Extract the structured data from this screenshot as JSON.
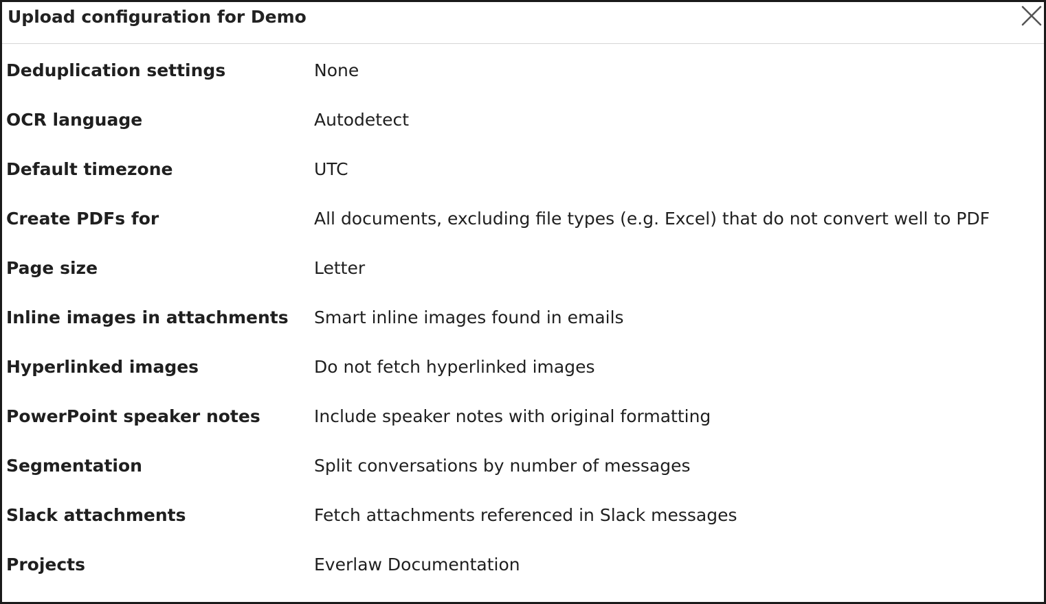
{
  "dialog": {
    "title": "Upload configuration for Demo",
    "close_icon": "close-icon"
  },
  "settings": [
    {
      "label": "Deduplication settings",
      "value": "None"
    },
    {
      "label": "OCR language",
      "value": "Autodetect"
    },
    {
      "label": "Default timezone",
      "value": "UTC"
    },
    {
      "label": "Create PDFs for",
      "value": "All documents, excluding file types (e.g. Excel) that do not convert well to PDF"
    },
    {
      "label": "Page size",
      "value": "Letter"
    },
    {
      "label": "Inline images in attachments",
      "value": "Smart inline images found in emails"
    },
    {
      "label": "Hyperlinked images",
      "value": "Do not fetch hyperlinked images"
    },
    {
      "label": "PowerPoint speaker notes",
      "value": "Include speaker notes with original formatting"
    },
    {
      "label": "Segmentation",
      "value": "Split conversations by number of messages"
    },
    {
      "label": "Slack attachments",
      "value": "Fetch attachments referenced in Slack messages"
    },
    {
      "label": "Projects",
      "value": "Everlaw Documentation"
    }
  ]
}
